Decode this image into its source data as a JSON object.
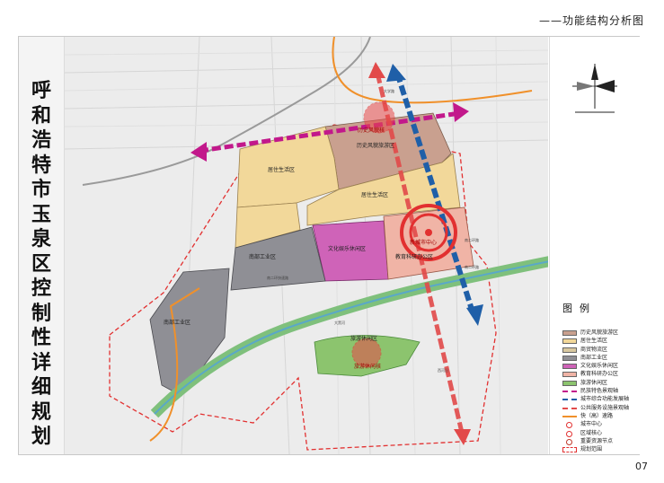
{
  "header": {
    "title": "——功能结构分析图"
  },
  "vertical_title": "呼和浩特市玉泉区控制性详细规划",
  "page_number": "07",
  "zones": {
    "residential_north": "居住生活区",
    "residential_mid": "居住生活区",
    "historic": "历史风貌旅游区",
    "historic_core": "历史风貌核",
    "culture": "文化娱乐休闲区",
    "south_industry_1": "南部工业区",
    "south_industry_2": "南部工业区",
    "education": "教育科研办公区",
    "city_center": "新城市中心",
    "tourism": "旅游休闲区",
    "tourism_core": "旅游休闲核"
  },
  "roads": {
    "r1": "南二环路",
    "r2": "南二环快速路",
    "r3": "南二环路",
    "r4": "大黑河",
    "r5": "大学路",
    "r6": "西河沿"
  },
  "legend": {
    "title": "图例",
    "items": [
      {
        "label": "历史风貌旅游区",
        "color": "#c9a08f"
      },
      {
        "label": "居住生活区",
        "color": "#f2d89a"
      },
      {
        "label": "商贸物流区",
        "color": "#d8c8a0"
      },
      {
        "label": "南部工业区",
        "color": "#8f8f95"
      },
      {
        "label": "文化娱乐休闲区",
        "color": "#cf63b8"
      },
      {
        "label": "教育科研办公区",
        "color": "#f0b4a6"
      },
      {
        "label": "旅游休闲区",
        "color": "#8cc46e"
      },
      {
        "label": "民族特色景观轴",
        "color": "#c2188b"
      },
      {
        "label": "城市综合功能发展轴",
        "color": "#1f5fa8"
      },
      {
        "label": "公共服务设施景观轴",
        "color": "#e24a4a"
      },
      {
        "label": "快（高）速路",
        "color": "#f0902a"
      },
      {
        "label": "城市中心",
        "color": "#e23030"
      },
      {
        "label": "区域核心",
        "color": "#e23030"
      },
      {
        "label": "重要资源节点",
        "color": "#c0392b"
      },
      {
        "label": "规划范围",
        "color": "#e23030"
      }
    ]
  },
  "colors": {
    "historic": "#c9a08f",
    "residential": "#f2d89a",
    "industry": "#8f8f95",
    "culture": "#cf63b8",
    "education": "#f0b4a6",
    "tourism": "#8cc46e",
    "river": "#7fc07c",
    "axis_magenta": "#c2188b",
    "axis_blue": "#1f5fa8",
    "axis_red": "#e24a4a",
    "highway": "#f0902a"
  }
}
